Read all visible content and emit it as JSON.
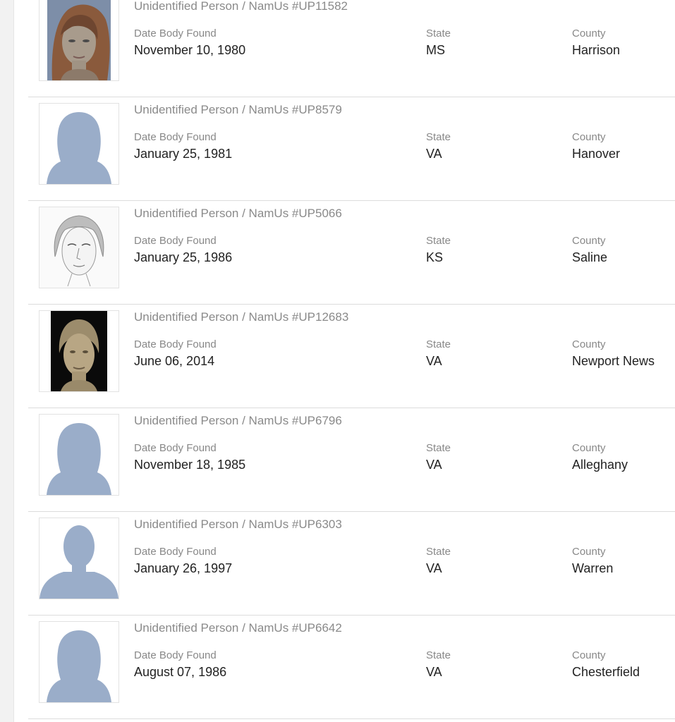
{
  "labels": {
    "date": "Date Body Found",
    "state": "State",
    "county": "County"
  },
  "records": [
    {
      "title": "Unidentified Person / NamUs #UP11582",
      "date": "November 10, 1980",
      "state": "MS",
      "county": "Harrison",
      "image": "reconstruction-photo"
    },
    {
      "title": "Unidentified Person / NamUs #UP8579",
      "date": "January 25, 1981",
      "state": "VA",
      "county": "Hanover",
      "image": "female-silhouette-placeholder"
    },
    {
      "title": "Unidentified Person / NamUs #UP5066",
      "date": "January 25, 1986",
      "state": "KS",
      "county": "Saline",
      "image": "pencil-sketch"
    },
    {
      "title": "Unidentified Person / NamUs #UP12683",
      "date": "June 06, 2014",
      "state": "VA",
      "county": "Newport News",
      "image": "clay-reconstruction"
    },
    {
      "title": "Unidentified Person / NamUs #UP6796",
      "date": "November 18, 1985",
      "state": "VA",
      "county": "Alleghany",
      "image": "female-silhouette-placeholder"
    },
    {
      "title": "Unidentified Person / NamUs #UP6303",
      "date": "January 26, 1997",
      "state": "VA",
      "county": "Warren",
      "image": "male-silhouette-placeholder"
    },
    {
      "title": "Unidentified Person / NamUs #UP6642",
      "date": "August 07, 1986",
      "state": "VA",
      "county": "Chesterfield",
      "image": "female-silhouette-placeholder"
    }
  ],
  "colors": {
    "silhouette": "#9aadc9",
    "title_text": "#8a8a8a",
    "label_text": "#888888",
    "value_text": "#222222",
    "divider": "#dcdcdc"
  }
}
